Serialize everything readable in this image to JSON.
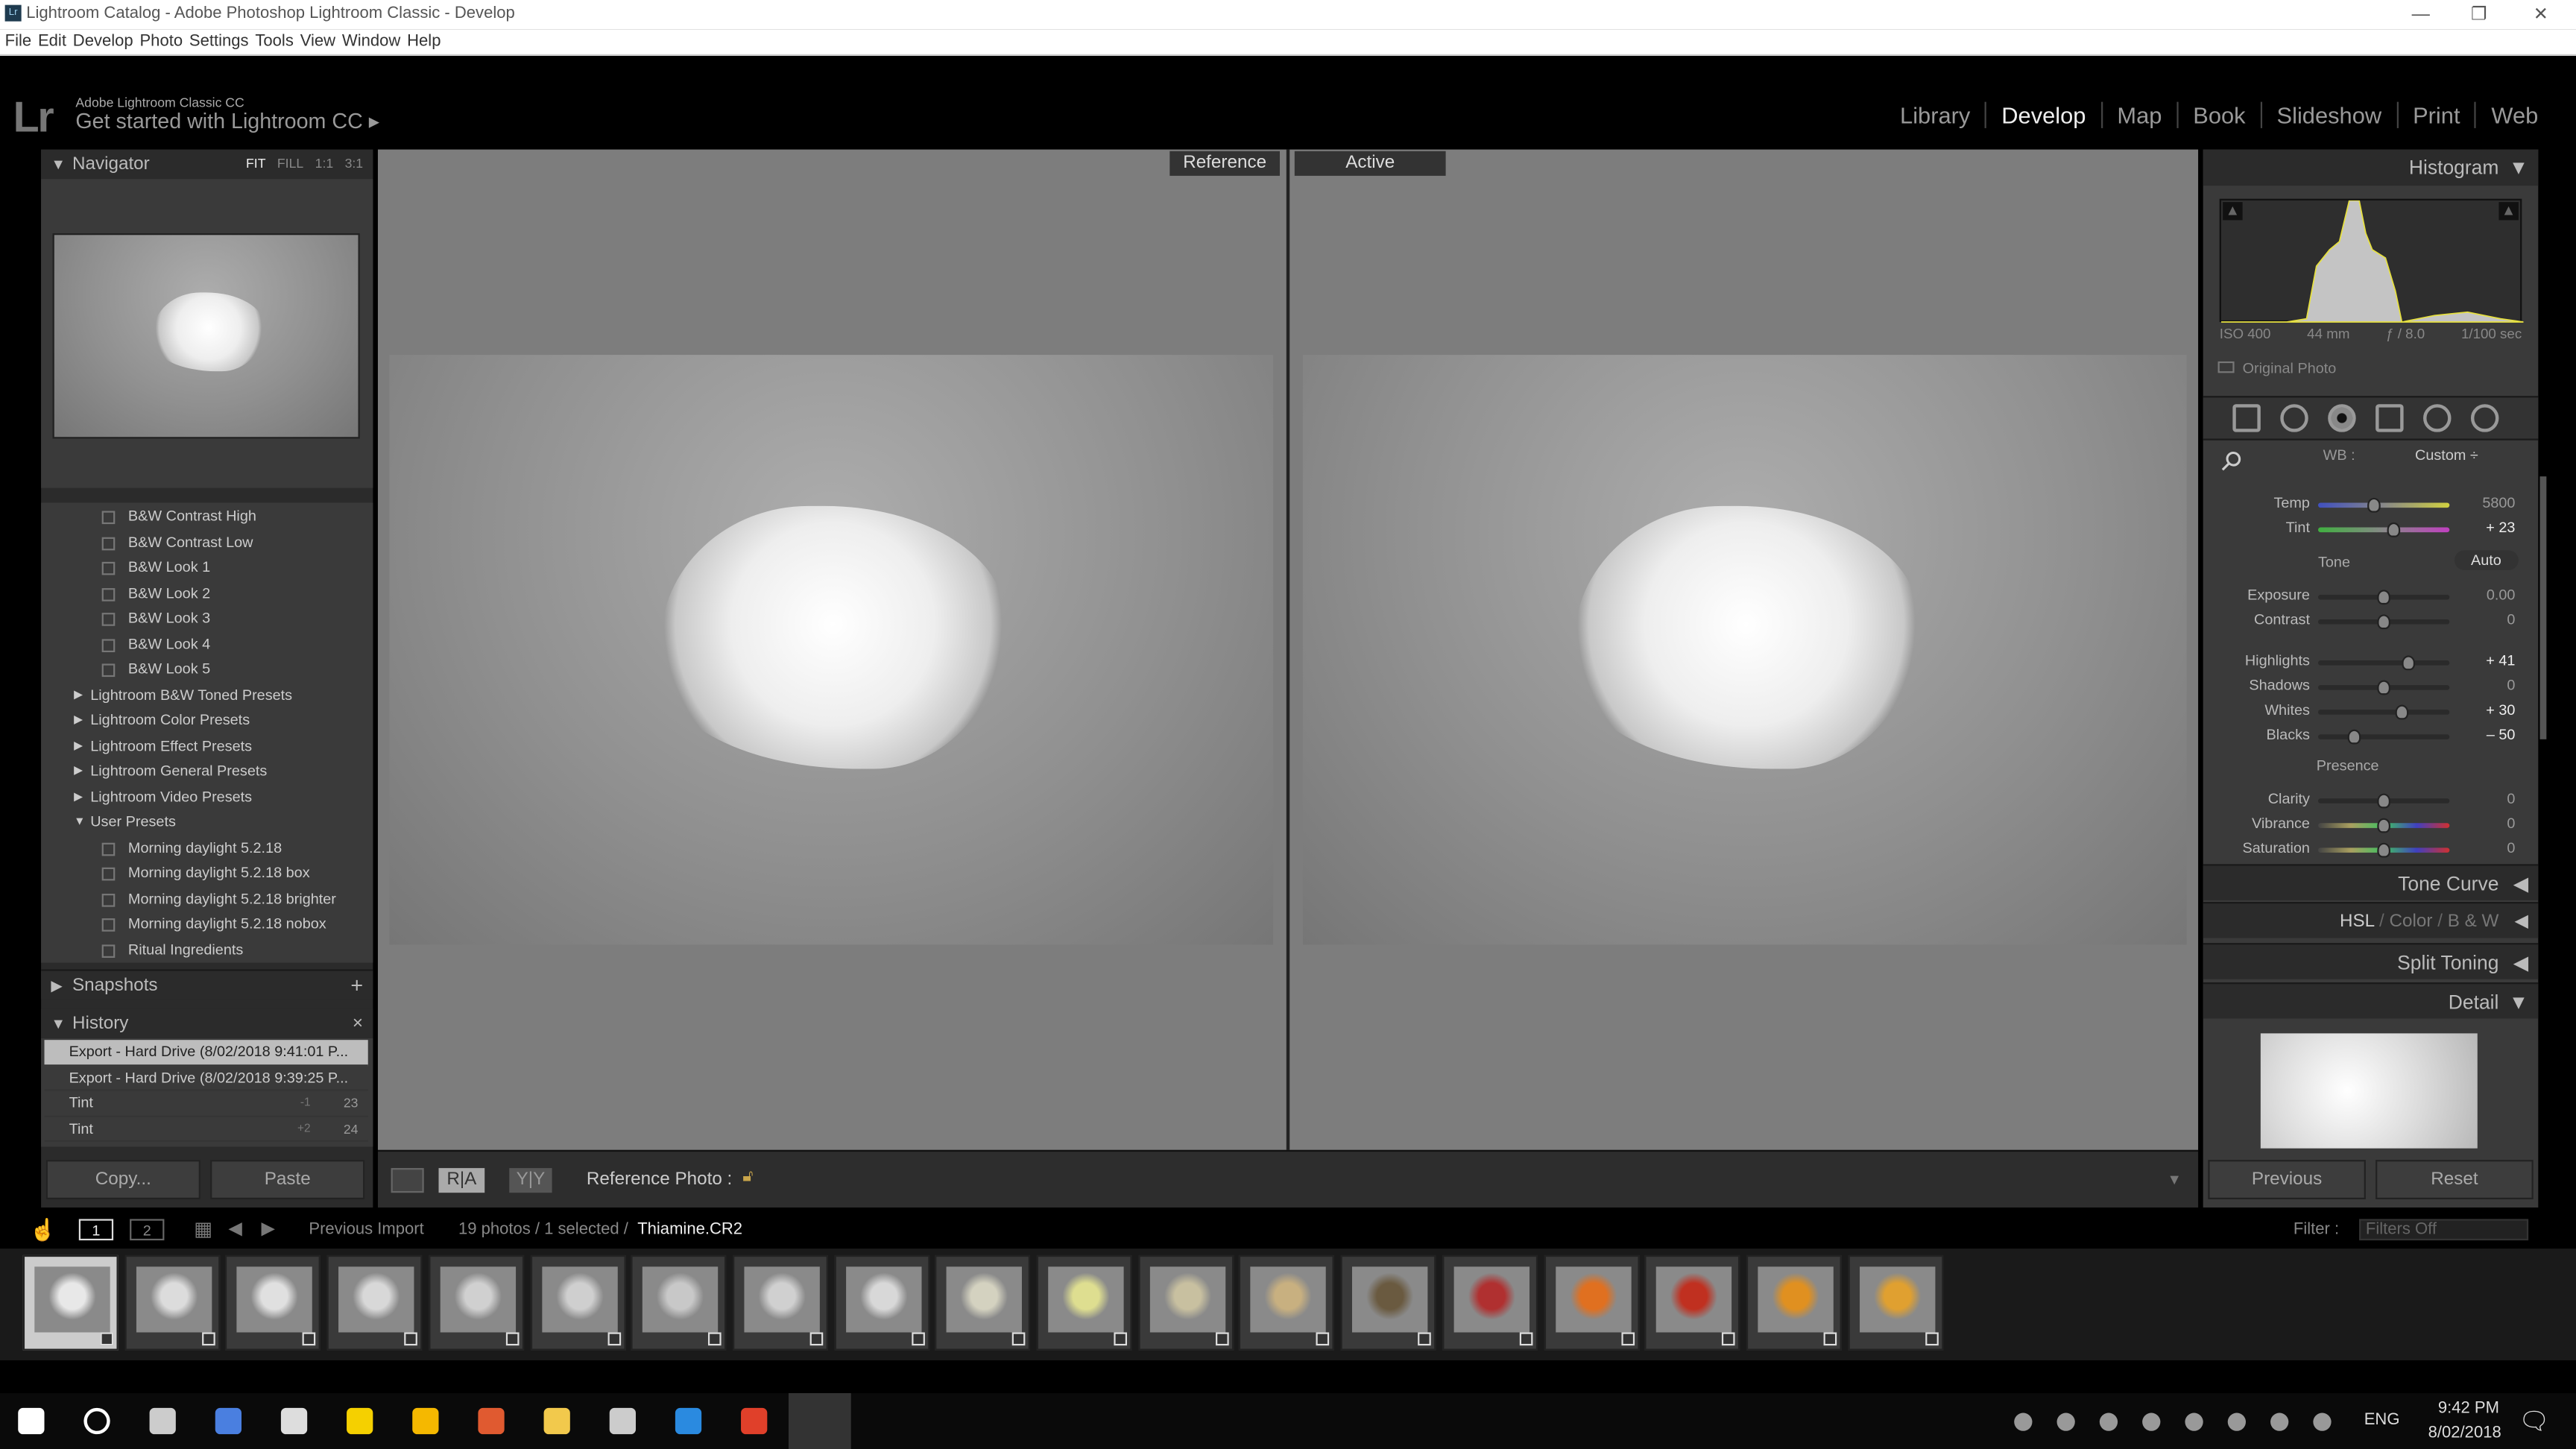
{
  "window": {
    "title": "Lightroom Catalog - Adobe Photoshop Lightroom Classic - Develop",
    "app_icon": "Lr"
  },
  "menu": [
    "File",
    "Edit",
    "Develop",
    "Photo",
    "Settings",
    "Tools",
    "View",
    "Window",
    "Help"
  ],
  "identity": {
    "logo": "Lr",
    "line1": "Adobe Lightroom Classic CC",
    "line2": "Get started with Lightroom CC ▸"
  },
  "modules": [
    {
      "label": "Library"
    },
    {
      "label": "Develop",
      "active": true
    },
    {
      "label": "Map"
    },
    {
      "label": "Book"
    },
    {
      "label": "Slideshow"
    },
    {
      "label": "Print"
    },
    {
      "label": "Web"
    }
  ],
  "navigator": {
    "title": "Navigator",
    "zoom": [
      "FIT",
      "FILL",
      "1:1",
      "3:1"
    ],
    "selected_zoom": "FIT"
  },
  "presets": [
    {
      "label": "B&W Contrast High",
      "type": "item"
    },
    {
      "label": "B&W Contrast Low",
      "type": "item"
    },
    {
      "label": "B&W Look 1",
      "type": "item"
    },
    {
      "label": "B&W Look 2",
      "type": "item"
    },
    {
      "label": "B&W Look 3",
      "type": "item"
    },
    {
      "label": "B&W Look 4",
      "type": "item"
    },
    {
      "label": "B&W Look 5",
      "type": "item"
    },
    {
      "label": "Lightroom B&W Toned Presets",
      "type": "folder"
    },
    {
      "label": "Lightroom Color Presets",
      "type": "folder"
    },
    {
      "label": "Lightroom Effect Presets",
      "type": "folder"
    },
    {
      "label": "Lightroom General Presets",
      "type": "folder"
    },
    {
      "label": "Lightroom Video Presets",
      "type": "folder"
    },
    {
      "label": "User Presets",
      "type": "open-folder"
    },
    {
      "label": "Morning daylight 5.2.18",
      "type": "item"
    },
    {
      "label": "Morning daylight 5.2.18 box",
      "type": "item"
    },
    {
      "label": "Morning daylight 5.2.18 brighter",
      "type": "item"
    },
    {
      "label": "Morning daylight 5.2.18 nobox",
      "type": "item"
    },
    {
      "label": "Ritual Ingredients",
      "type": "item"
    }
  ],
  "snapshots": {
    "title": "Snapshots",
    "add": "+"
  },
  "history": {
    "title": "History",
    "clear": "×",
    "items": [
      {
        "label": "Export - Hard Drive (8/02/2018 9:41:01 P...",
        "delta": "",
        "value": "",
        "selected": true
      },
      {
        "label": "Export - Hard Drive (8/02/2018 9:39:25 P...",
        "delta": "",
        "value": ""
      },
      {
        "label": "Tint",
        "delta": "-1",
        "value": "23"
      },
      {
        "label": "Tint",
        "delta": "+2",
        "value": "24"
      }
    ]
  },
  "left_buttons": {
    "copy": "Copy...",
    "paste": "Paste"
  },
  "compare": {
    "reference": "Reference",
    "active": "Active"
  },
  "toolbar": {
    "reference_photo": "Reference Photo :",
    "view_ra": "R|A",
    "view_yy": "Y|Y"
  },
  "histogram": {
    "title": "Histogram",
    "iso": "ISO 400",
    "focal": "44 mm",
    "aperture": "ƒ / 8.0",
    "shutter": "1/100 sec",
    "original_photo": "Original Photo"
  },
  "basic": {
    "wb_label": "WB :",
    "wb_value": "Custom ÷",
    "tone": "Tone",
    "auto": "Auto",
    "presence": "Presence",
    "sliders": [
      {
        "label": "Temp",
        "value": "5800",
        "pos": 0.42,
        "track": "temp"
      },
      {
        "label": "Tint",
        "value": "+ 23",
        "pos": 0.57,
        "track": "tint",
        "bright": true
      },
      {
        "label": "Exposure",
        "value": "0.00",
        "pos": 0.5
      },
      {
        "label": "Contrast",
        "value": "0",
        "pos": 0.5
      },
      {
        "label": "Highlights",
        "value": "+ 41",
        "pos": 0.69,
        "bright": true
      },
      {
        "label": "Shadows",
        "value": "0",
        "pos": 0.5
      },
      {
        "label": "Whites",
        "value": "+ 30",
        "pos": 0.64,
        "bright": true
      },
      {
        "label": "Blacks",
        "value": "– 50",
        "pos": 0.28,
        "bright": true
      },
      {
        "label": "Clarity",
        "value": "0",
        "pos": 0.5
      },
      {
        "label": "Vibrance",
        "value": "0",
        "pos": 0.5,
        "track": "color"
      },
      {
        "label": "Saturation",
        "value": "0",
        "pos": 0.5,
        "track": "color"
      }
    ]
  },
  "sections": {
    "tone_curve": "Tone Curve",
    "hsl": "HSL",
    "color": "Color",
    "bw": "B & W",
    "sep": "/",
    "split_toning": "Split Toning",
    "detail": "Detail"
  },
  "right_buttons": {
    "previous": "Previous",
    "reset": "Reset"
  },
  "filmstrip": {
    "source": "Previous Import",
    "count": "19 photos / 1 selected /",
    "filename": "Thiamine.CR2",
    "filter_label": "Filter :",
    "filter_value": "Filters Off",
    "pages": [
      "1",
      "2"
    ],
    "thumb_tints": [
      "#e8e8e8",
      "#dcdcdc",
      "#e0e0e0",
      "#d8d8d8",
      "#d0d0d0",
      "#cfcfcf",
      "#c8c8c8",
      "#d0d0d0",
      "#d8d8d8",
      "#d4d2c0",
      "#dede90",
      "#c8c0a0",
      "#c8b080",
      "#6a5a40",
      "#b03030",
      "#e07020",
      "#c03020",
      "#e09020",
      "#e0a030"
    ]
  },
  "taskbar": {
    "time": "9:42 PM",
    "date": "8/02/2018",
    "lang": "ENG",
    "apps": [
      "windows-start-icon",
      "cortana-icon",
      "task-view-icon",
      "people-icon",
      "calculator-icon",
      "sticky-notes-icon",
      "keep-icon",
      "photos-icon",
      "file-explorer-icon",
      "3d-icon",
      "vscode-icon",
      "chrome-icon",
      "lightroom-icon"
    ],
    "app_colors": [
      "#fff",
      "#fff",
      "#ccc",
      "#4a7fe0",
      "#ddd",
      "#f5d000",
      "#f5b800",
      "#e05a30",
      "#f2c94c",
      "#ccc",
      "#2a8ae0",
      "#e0402a",
      "#2a3a4a"
    ],
    "tray": [
      "show-hidden-icon",
      "creative-cloud-icon",
      "color-sync-icon",
      "calibration-icon",
      "battery-icon",
      "wifi-icon",
      "volume-icon",
      "pen-icon"
    ],
    "colors": {
      "accent": "#31a8ff"
    }
  }
}
